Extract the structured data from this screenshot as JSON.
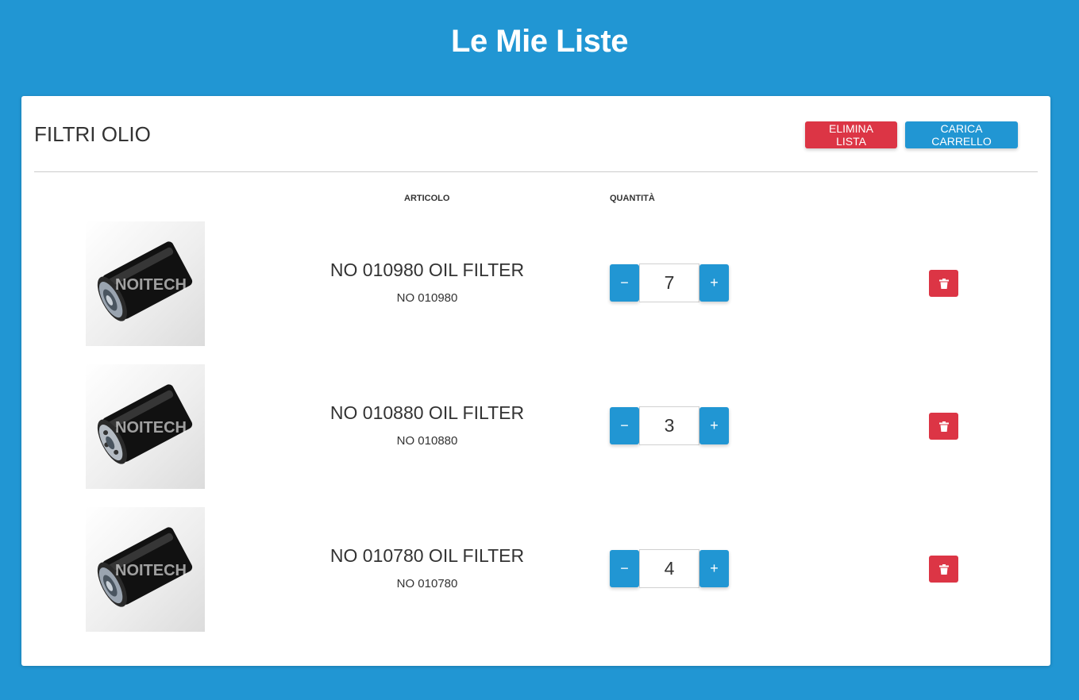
{
  "header": {
    "title": "Le Mie Liste"
  },
  "list": {
    "title": "FILTRI OLIO",
    "delete_list_label": "ELIMINA LISTA",
    "load_cart_label": "CARICA CARRELLO",
    "column_article": "ARTICOLO",
    "column_quantity": "QUANTITÀ",
    "items": [
      {
        "name": "NO 010980 OIL FILTER",
        "code": "NO 010980",
        "quantity": "7",
        "image_watermark": "NOITECH"
      },
      {
        "name": "NO 010880 OIL FILTER",
        "code": "NO 010880",
        "quantity": "3",
        "image_watermark": "NOITECH"
      },
      {
        "name": "NO 010780 OIL FILTER",
        "code": "NO 010780",
        "quantity": "4",
        "image_watermark": "NOITECH"
      }
    ]
  },
  "stepper": {
    "minus_symbol": "−",
    "plus_symbol": "+"
  },
  "icons": {
    "delete_item": "trash-icon",
    "product": "oil-filter-image"
  },
  "colors": {
    "background": "#2196d3",
    "primary": "#2196d3",
    "danger": "#dc3545",
    "card": "#ffffff",
    "text": "#333333"
  }
}
